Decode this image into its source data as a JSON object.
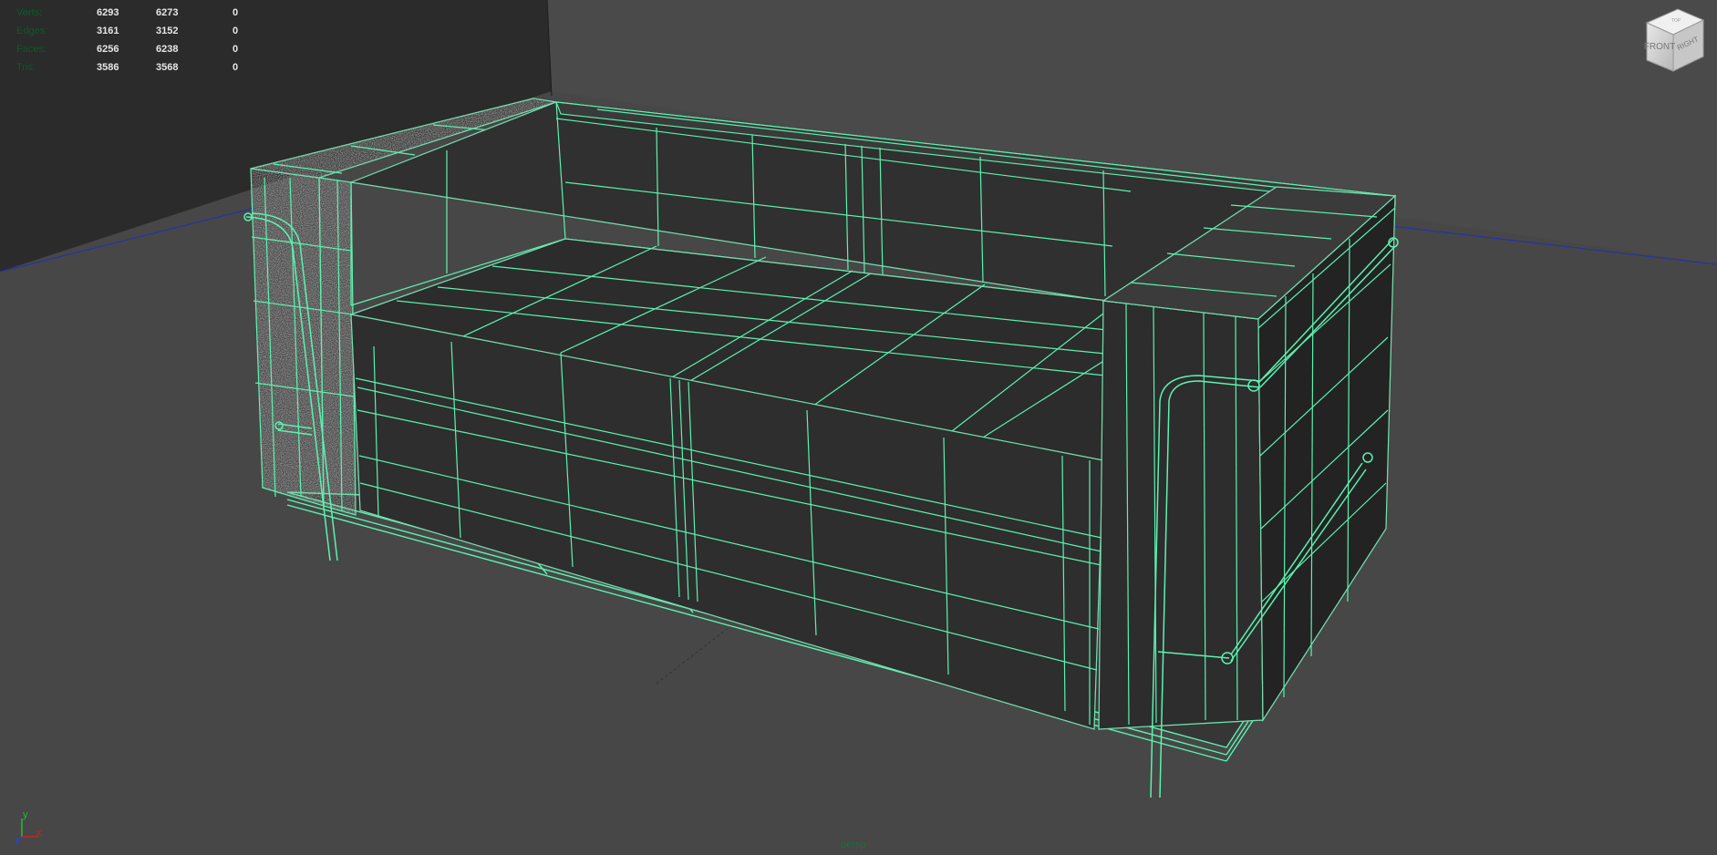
{
  "hud": {
    "rows": [
      {
        "label": "Verts:",
        "value1": "6293",
        "value2": "6273",
        "value3": "0"
      },
      {
        "label": "Edges:",
        "value1": "3161",
        "value2": "3152",
        "value3": "0"
      },
      {
        "label": "Faces:",
        "value1": "6256",
        "value2": "6238",
        "value3": "0"
      },
      {
        "label": "Tris:",
        "value1": "3586",
        "value2": "3568",
        "value3": "0"
      }
    ]
  },
  "view_cube": {
    "front_label": "FRONT",
    "right_label": "RIGHT",
    "top_label": "TOP"
  },
  "camera": {
    "name": "persp"
  },
  "axis": {
    "x_label": "x",
    "y_label": "y",
    "z_label": "z"
  },
  "colors": {
    "viewport_background": "#444444",
    "wire": "#5cf2b0",
    "hud_label": "#0b5a2c",
    "hud_value": "#e6e6e6",
    "horizon_line": "#2233aa",
    "axis_x": "#cc2222",
    "axis_y": "#22bb33",
    "axis_z": "#2244dd"
  }
}
